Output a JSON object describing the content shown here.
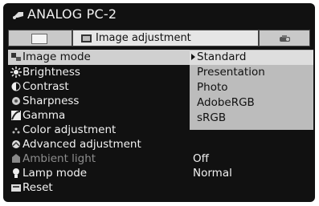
{
  "window": {
    "title": "ANALOG PC-2"
  },
  "tabs": [
    {
      "icon": "screen-rect-icon"
    },
    {
      "icon": "image-adjust-icon",
      "label": "Image adjustment"
    },
    {
      "icon": "projector-icon"
    }
  ],
  "menu": {
    "items": [
      {
        "label": "Image mode",
        "icon": "image-mode-icon"
      },
      {
        "label": "Brightness",
        "icon": "brightness-icon"
      },
      {
        "label": "Contrast",
        "icon": "contrast-icon"
      },
      {
        "label": "Sharpness",
        "icon": "sharpness-icon"
      },
      {
        "label": "Gamma",
        "icon": "gamma-icon"
      },
      {
        "label": "Color adjustment",
        "icon": "color-adjust-icon"
      },
      {
        "label": "Advanced adjustment",
        "icon": "advanced-adjust-icon"
      },
      {
        "label": "Ambient light",
        "icon": "ambient-light-icon"
      },
      {
        "label": "Lamp mode",
        "icon": "lamp-icon"
      },
      {
        "label": "Reset",
        "icon": "reset-icon"
      }
    ],
    "selected": "Image mode"
  },
  "values": {
    "ambient_light": "Off",
    "lamp_mode": "Normal"
  },
  "dropdown": {
    "options": [
      "Standard",
      "Presentation",
      "Photo",
      "AdobeRGB",
      "sRGB"
    ],
    "selected": "Standard"
  },
  "colors": {
    "background": "#111111",
    "tab_bar": "#d6d6d6",
    "selection": "#d0d0d0",
    "dropdown": "#bcbcbc",
    "text": "#f2f2f2",
    "dim_text": "#8d8d8d"
  }
}
